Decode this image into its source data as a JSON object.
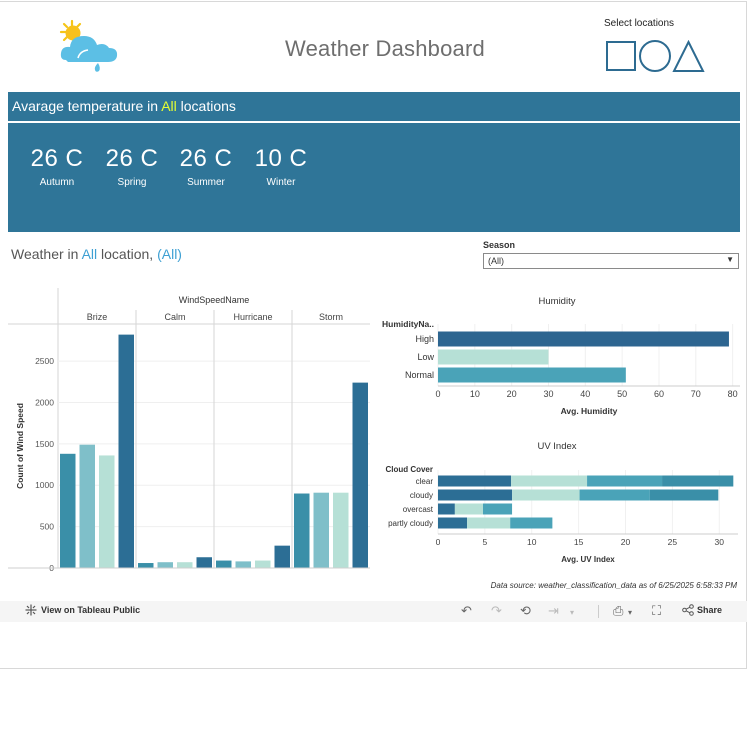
{
  "header": {
    "title": "Weather Dashboard",
    "select_locations_label": "Select locations"
  },
  "temperature": {
    "banner_prefix": "Avarage temperature in",
    "banner_highlight": "All",
    "banner_suffix": "locations",
    "items": [
      {
        "value": "26 C",
        "label": "Autumn"
      },
      {
        "value": "26 C",
        "label": "Spring"
      },
      {
        "value": "26 C",
        "label": "Summer"
      },
      {
        "value": "10 C",
        "label": "Winter"
      }
    ]
  },
  "weather_section": {
    "prefix": "Weather in",
    "location": "All",
    "middle": "location,",
    "season": "(All)"
  },
  "season_filter": {
    "label": "Season",
    "value": "(All)"
  },
  "chart_data": [
    {
      "type": "bar",
      "column_header": "WindSpeedName",
      "categories": [
        "Brize",
        "Calm",
        "Hurricane",
        "Storm"
      ],
      "ylabel": "Count of Wind Speed",
      "yticks": [
        0,
        500,
        1000,
        1500,
        2000,
        2500
      ],
      "ylim": [
        0,
        2900
      ],
      "series_colors": [
        "#3a8fa8",
        "#7fbfc9",
        "#b6e0d6",
        "#2c6e95"
      ],
      "values": [
        [
          1380,
          1490,
          1360,
          2820
        ],
        [
          60,
          70,
          70,
          130
        ],
        [
          90,
          80,
          90,
          270
        ],
        [
          900,
          910,
          910,
          2240
        ]
      ]
    },
    {
      "type": "bar",
      "title": "Humidity",
      "row_header": "HumidityNa..",
      "categories": [
        "High",
        "Low",
        "Normal"
      ],
      "values": [
        79,
        30,
        51
      ],
      "colors": [
        "#2d6590",
        "#b6e0d6",
        "#4aa3b8"
      ],
      "xlabel": "Avg. Humidity",
      "xticks": [
        0,
        10,
        20,
        30,
        40,
        50,
        60,
        70,
        80
      ],
      "xlim": [
        0,
        82
      ]
    },
    {
      "type": "bar",
      "title": "UV Index",
      "row_header": "Cloud Cover",
      "categories": [
        "clear",
        "cloudy",
        "overcast",
        "partly cloudy"
      ],
      "segment_colors": [
        "#2c6e95",
        "#b6e0d6",
        "#4aa3b8",
        "#3a8fa8"
      ],
      "segments": [
        [
          7.8,
          8.1,
          8.0,
          7.6
        ],
        [
          7.9,
          7.2,
          7.5,
          7.3
        ],
        [
          1.8,
          3.0,
          3.1
        ],
        [
          3.1,
          4.6,
          4.5
        ]
      ],
      "xlabel": "Avg. UV Index",
      "xticks": [
        0,
        5,
        10,
        15,
        20,
        25,
        30
      ],
      "xlim": [
        0,
        32
      ]
    }
  ],
  "footer": {
    "data_source": "Data source: weather_classification_data as of 6/25/2025 6:58:33 PM"
  },
  "toolbar": {
    "view_label": "View on Tableau Public",
    "share_label": "Share"
  }
}
